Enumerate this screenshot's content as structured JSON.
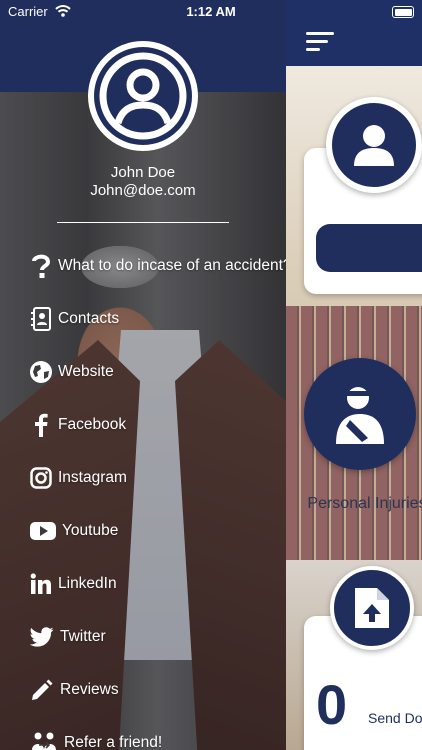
{
  "status_bar": {
    "carrier": "Carrier",
    "time": "1:12 AM"
  },
  "user": {
    "name": "John Doe",
    "email": "John@doe.com"
  },
  "menu": [
    {
      "label": "What to do incase of an accident?",
      "icon": "question-icon"
    },
    {
      "label": "Contacts",
      "icon": "contacts-icon"
    },
    {
      "label": "Website",
      "icon": "globe-icon"
    },
    {
      "label": "Facebook",
      "icon": "facebook-icon"
    },
    {
      "label": "Instagram",
      "icon": "instagram-icon"
    },
    {
      "label": "Youtube",
      "icon": "youtube-icon"
    },
    {
      "label": "LinkedIn",
      "icon": "linkedin-icon"
    },
    {
      "label": "Twitter",
      "icon": "twitter-icon"
    },
    {
      "label": "Reviews",
      "icon": "pencil-icon"
    },
    {
      "label": "Refer a friend!",
      "icon": "refer-icon"
    }
  ],
  "main": {
    "personal_injuries": "Personal Injuries",
    "count": "0",
    "send_label": "Send Do"
  },
  "colors": {
    "navy": "#1f2e5c",
    "white": "#ffffff"
  }
}
